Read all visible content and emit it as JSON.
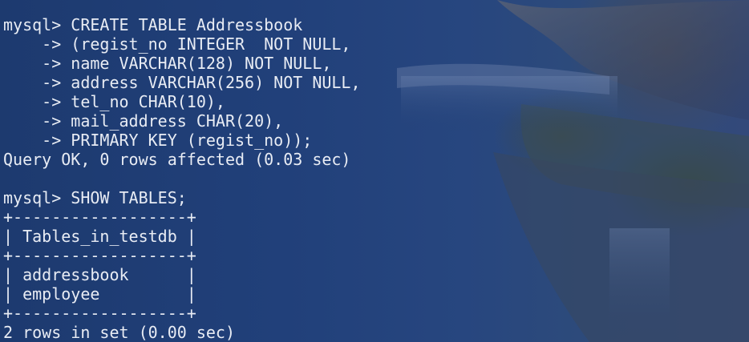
{
  "terminal": {
    "lines": [
      "mysql> CREATE TABLE Addressbook",
      "    -> (regist_no INTEGER  NOT NULL,",
      "    -> name VARCHAR(128) NOT NULL,",
      "    -> address VARCHAR(256) NOT NULL,",
      "    -> tel_no CHAR(10),",
      "    -> mail_address CHAR(20),",
      "    -> PRIMARY KEY (regist_no));",
      "Query OK, 0 rows affected (0.03 sec)",
      "",
      "mysql> SHOW TABLES;",
      "+------------------+",
      "| Tables_in_testdb |",
      "+------------------+",
      "| addressbook      |",
      "| employee         |",
      "+------------------+",
      "2 rows in set (0.00 sec)"
    ]
  }
}
